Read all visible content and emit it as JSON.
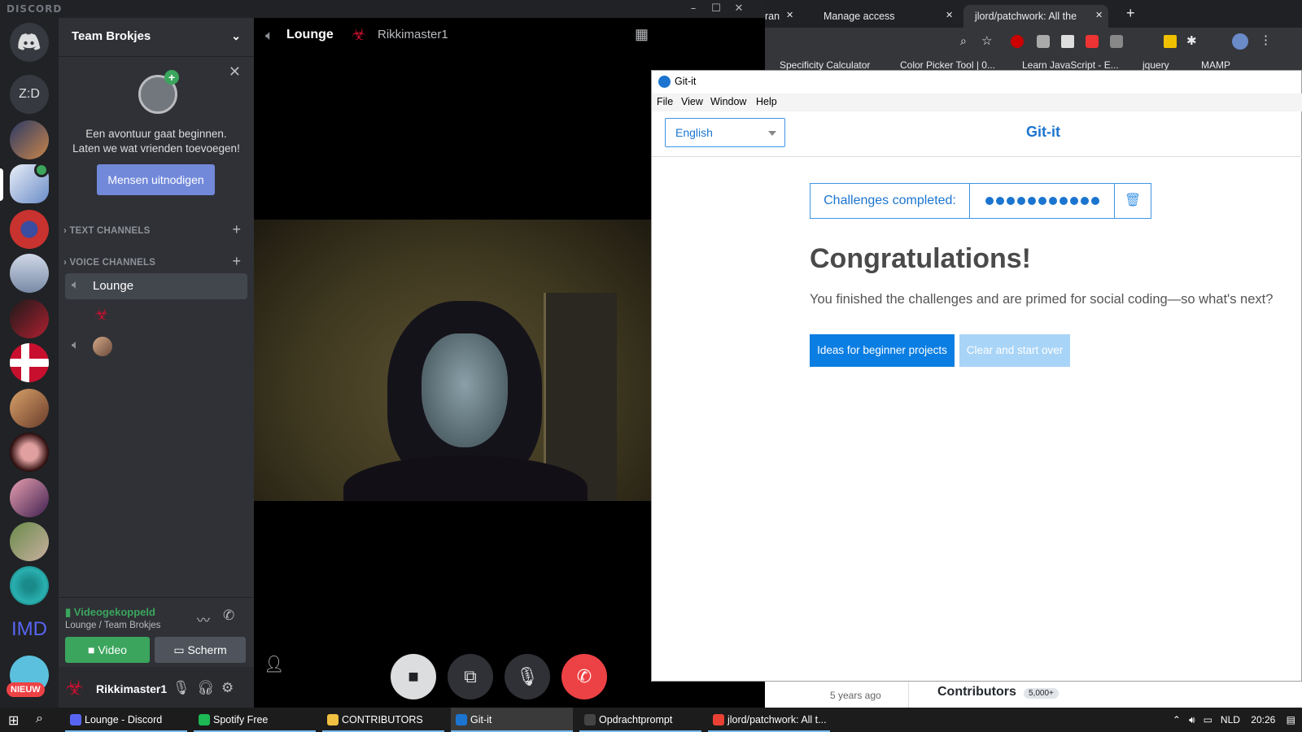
{
  "discord": {
    "brand": "DISCORD",
    "guild_name": "Team Brokjes",
    "invite": {
      "line1": "Een avontuur gaat beginnen.",
      "line2": "Laten we wat vrienden toevoegen!",
      "button": "Mensen uitnodigen"
    },
    "categories": {
      "text": "TEXT CHANNELS",
      "voice": "VOICE CHANNELS"
    },
    "voice_channel": "Lounge",
    "voice_status": "Videogekoppeld",
    "voice_location": "Lounge / Team Brokjes",
    "video_button": "Video",
    "screen_button": "Scherm",
    "username": "Rikkimaster1",
    "video_header_channel": "Lounge",
    "video_header_user": "Rikkimaster1",
    "server_labels": {
      "zd": "Z:D",
      "imd": "IMD",
      "new_badge": "NIEUW"
    },
    "colors": {
      "accent": "#7289da",
      "online": "#3ba55d",
      "danger": "#ed4245"
    }
  },
  "chrome": {
    "tabs": [
      "ran",
      "Manage access",
      "jlord/patchwork: All the"
    ],
    "bookmarks": [
      "Specificity Calculator",
      "Color Picker Tool | 0...",
      "Learn JavaScript - E...",
      "jquery",
      "MAMP"
    ],
    "page_fragment": {
      "left": "5 years ago",
      "right": "Contributors",
      "badge": "5,000+"
    }
  },
  "gitit": {
    "window_title": "Git-it",
    "menu": [
      "File",
      "View",
      "Window",
      "Help"
    ],
    "language": "English",
    "brand": "Git-it",
    "progress_label": "Challenges completed:",
    "challenges_completed": 11,
    "heading": "Congratulations!",
    "message": "You finished the challenges and are primed for social coding—so what's next?",
    "primary_button": "Ideas for beginner projects",
    "secondary_button": "Clear and start over",
    "colors": {
      "accent": "#1b75d0",
      "button": "#0b7ee3",
      "button_disabled": "#a8d4f7"
    }
  },
  "taskbar": {
    "items": [
      {
        "label": "Lounge - Discord",
        "color": "#5865f2"
      },
      {
        "label": "Spotify Free",
        "color": "#1db954"
      },
      {
        "label": "CONTRIBUTORS",
        "color": "#f0c040"
      },
      {
        "label": "Git-it",
        "color": "#1b75d0"
      },
      {
        "label": "Opdrachtprompt",
        "color": "#444444"
      },
      {
        "label": "jlord/patchwork: All t...",
        "color": "#e94235"
      }
    ],
    "lang": "NLD",
    "time": "20:26"
  }
}
